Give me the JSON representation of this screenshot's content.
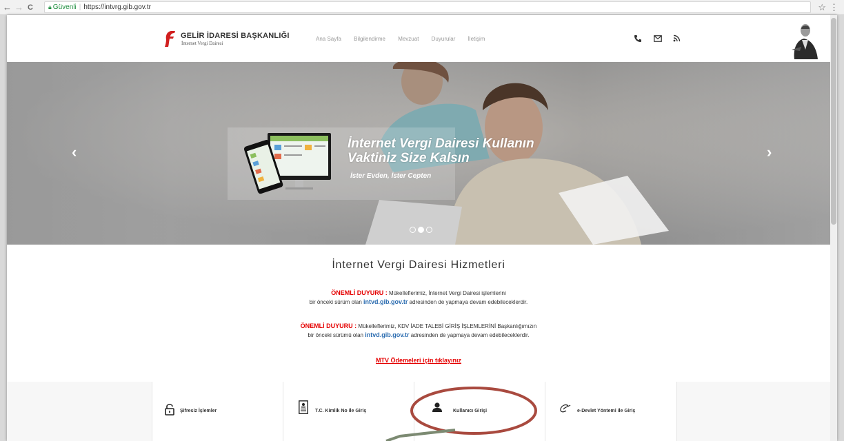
{
  "browser": {
    "back": "←",
    "forward": "→",
    "reload": "C",
    "secure_label": "Güvenli",
    "url": "https://intvrg.gib.gov.tr",
    "star": "☆",
    "menu": "⋮"
  },
  "header": {
    "logo_title": "GELİR İDARESİ BAŞKANLIĞI",
    "logo_subtitle": "İnternet Vergi Dairesi",
    "nav": [
      "Ana Sayfa",
      "Bilgilendirme",
      "Mevzuat",
      "Duyurular",
      "İletişim"
    ],
    "icons": [
      "phone-icon",
      "mail-icon",
      "rss-icon"
    ]
  },
  "hero": {
    "title_line1": "İnternet Vergi Dairesi Kullanın",
    "title_line2": "Vaktiniz Size Kalsın",
    "subtitle": "İster Evden, İster Cepten",
    "prev": "‹",
    "next": "›",
    "slides": 3,
    "active_slide": 2
  },
  "main": {
    "title": "İnternet Vergi Dairesi Hizmetleri",
    "notice1": {
      "label": "ÖNEMLİ DUYURU :",
      "line1": "Mükelleflerimiz, İnternet Vergi Dairesi işlemlerini",
      "line2_pre": "bir önceki sürüm olan",
      "link": "intvd.gib.gov.tr",
      "line2_post": "adresinden de yapmaya devam edebileceklerdir."
    },
    "notice2": {
      "label": "ÖNEMLİ DUYURU :",
      "line1": "Mükelleflerimiz, KDV İADE TALEBİ GİRİŞ İŞLEMLERİNİ Başkanlığımızın",
      "line2_pre": "bir önceki sürümü olan",
      "link": "intvd.gib.gov.tr",
      "line2_post": "adresinden de yapmaya devam edebileceklerdir."
    },
    "mtv_link": "MTV Ödemeleri için tıklayınız"
  },
  "tiles": [
    {
      "label": "Şifresiz İşlemler",
      "icon": "unlock-icon"
    },
    {
      "label": "T.C. Kimlik No ile Giriş",
      "icon": "id-card-icon"
    },
    {
      "label": "Kullanıcı Girişi",
      "icon": "user-icon"
    },
    {
      "label": "e-Devlet Yöntemi ile Giriş",
      "icon": "edevlet-icon"
    }
  ],
  "colors": {
    "accent_red": "#e50000",
    "link_blue": "#2b6cb0",
    "annotation": "#a94a3f",
    "logo_red": "#d11f1f"
  }
}
